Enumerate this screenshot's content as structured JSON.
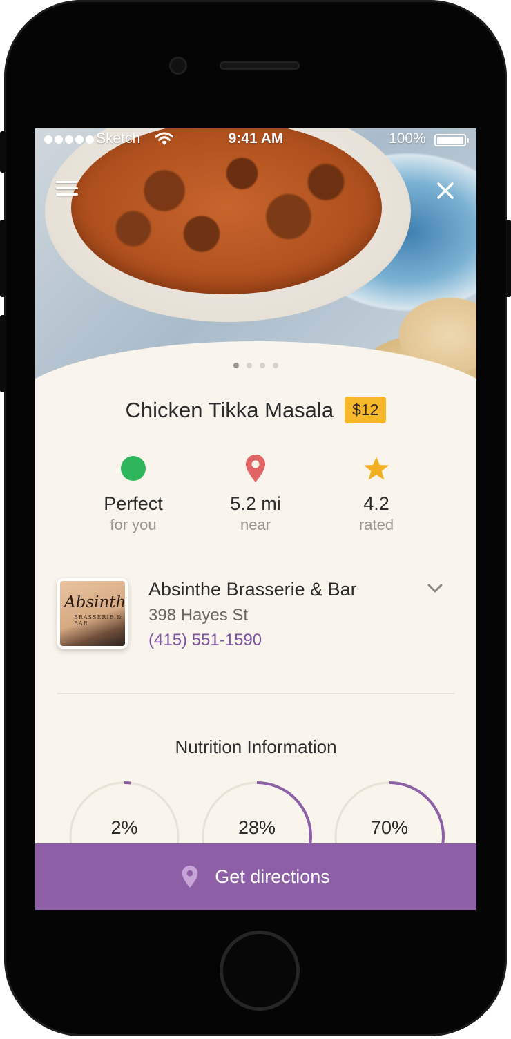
{
  "status_bar": {
    "carrier": "Sketch",
    "time": "9:41 AM",
    "battery": "100%"
  },
  "hero": {
    "icons": {
      "menu": "hamburger-menu-icon",
      "close": "close-icon"
    },
    "page_count": 4,
    "active_page": 1
  },
  "dish": {
    "name": "Chicken Tikka Masala",
    "price": "$12"
  },
  "stats": [
    {
      "value": "Perfect",
      "sub": "for you",
      "icon": "green-circle-icon",
      "color": "#2fb55b"
    },
    {
      "value": "5.2 mi",
      "sub": "near",
      "icon": "location-pin-icon",
      "color": "#e06464"
    },
    {
      "value": "4.2",
      "sub": "rated",
      "icon": "star-icon",
      "color": "#f2b01e"
    }
  ],
  "restaurant": {
    "name": "Absinthe Brasserie & Bar",
    "address": "398 Hayes St",
    "phone": "(415) 551-1590",
    "thumbnail_text": {
      "script": "Absinthe",
      "sub": "BRASSERIE & BAR"
    }
  },
  "nutrition": {
    "title": "Nutrition Information",
    "rings": [
      {
        "label": "2%",
        "fraction": 0.02
      },
      {
        "label": "28%",
        "fraction": 0.28
      },
      {
        "label": "70%",
        "fraction": 0.7
      }
    ]
  },
  "cta": {
    "label": "Get directions",
    "icon": "location-pin-icon"
  },
  "colors": {
    "accent": "#8d5fa6",
    "price_badge": "#f7b72a",
    "phone_link": "#7e55a3",
    "background": "#faf5ec"
  }
}
